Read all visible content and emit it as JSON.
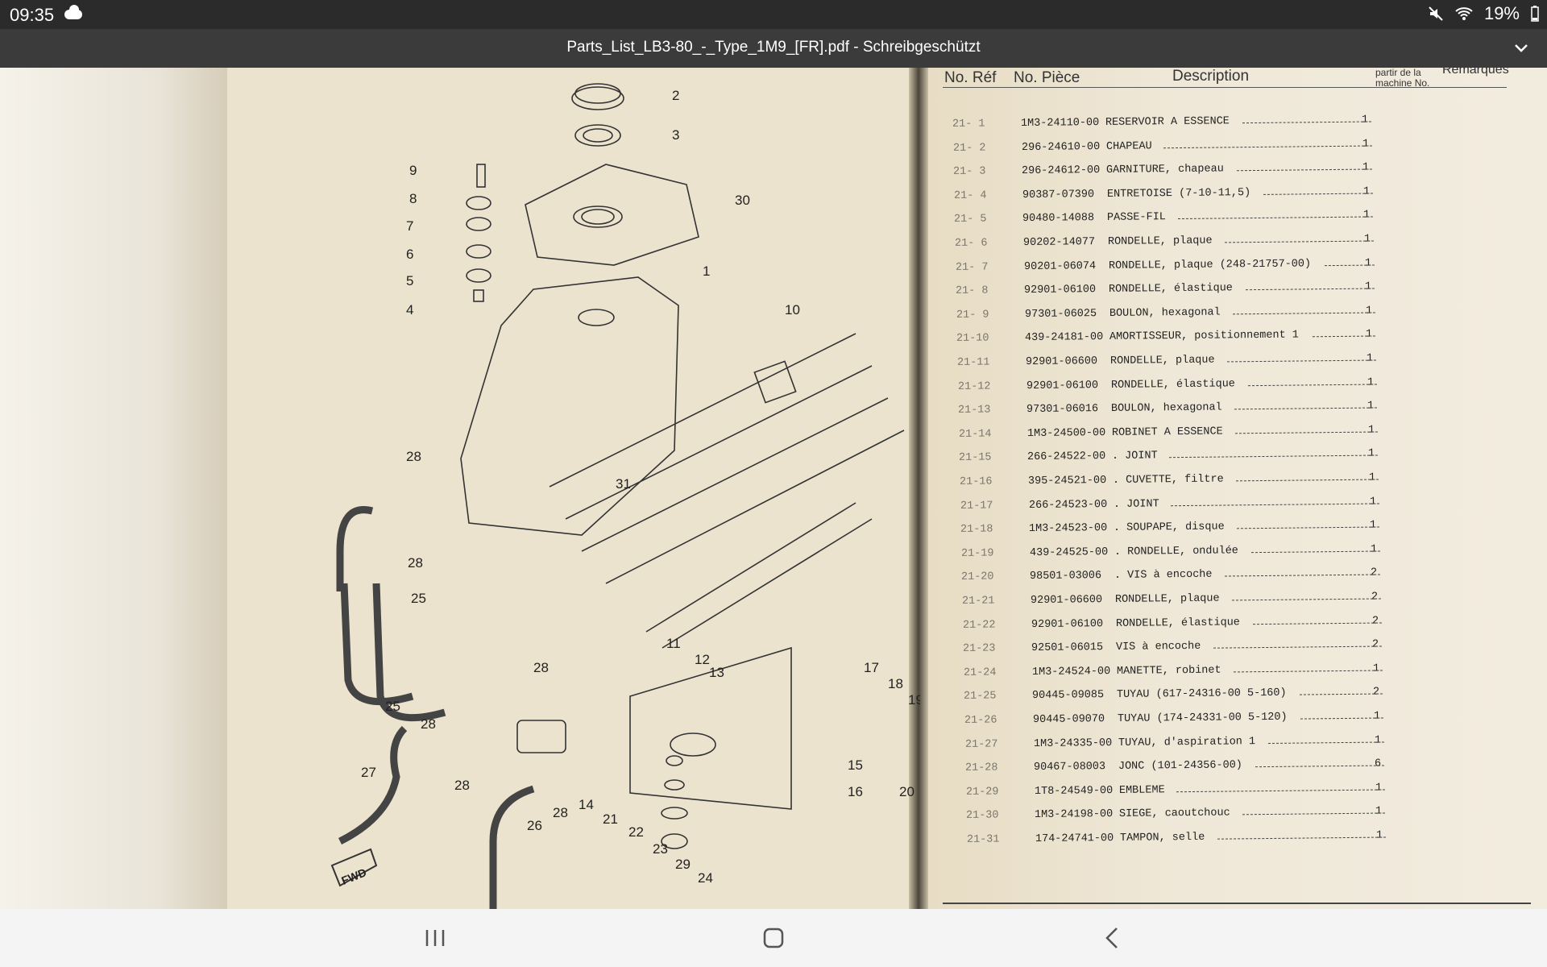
{
  "status": {
    "time": "09:35",
    "battery": "19%"
  },
  "title_bar": {
    "title": "Parts_List_LB3-80_-_Type_1M9_[FR].pdf - Schreibgeschützt"
  },
  "parts_table": {
    "headers": {
      "ref": "No. Réf",
      "part": "No. Pièce",
      "description": "Description",
      "remarks": "Remarques",
      "applicable": "partir de la\nmachine No."
    },
    "rows": [
      {
        "ref": "21- 1",
        "part": "1M3-24110-00",
        "desc": "RESERVOIR A ESSENCE",
        "qty": "1"
      },
      {
        "ref": "21- 2",
        "part": "296-24610-00",
        "desc": "CHAPEAU",
        "qty": "1"
      },
      {
        "ref": "21- 3",
        "part": "296-24612-00",
        "desc": "GARNITURE, chapeau",
        "qty": "1"
      },
      {
        "ref": "21- 4",
        "part": "90387-07390",
        "desc": "ENTRETOISE (7-10-11,5)",
        "qty": "1"
      },
      {
        "ref": "21- 5",
        "part": "90480-14088",
        "desc": "PASSE-FIL",
        "qty": "1"
      },
      {
        "ref": "21- 6",
        "part": "90202-14077",
        "desc": "RONDELLE, plaque",
        "qty": "1"
      },
      {
        "ref": "21- 7",
        "part": "90201-06074",
        "desc": "RONDELLE, plaque (248-21757-00)",
        "qty": "1"
      },
      {
        "ref": "21- 8",
        "part": "92901-06100",
        "desc": "RONDELLE, élastique",
        "qty": "1"
      },
      {
        "ref": "21- 9",
        "part": "97301-06025",
        "desc": "BOULON, hexagonal",
        "qty": "1"
      },
      {
        "ref": "21-10",
        "part": "439-24181-00",
        "desc": "AMORTISSEUR, positionnement 1",
        "qty": "1"
      },
      {
        "ref": "21-11",
        "part": "92901-06600",
        "desc": "RONDELLE, plaque",
        "qty": "1"
      },
      {
        "ref": "21-12",
        "part": "92901-06100",
        "desc": "RONDELLE, élastique",
        "qty": "1"
      },
      {
        "ref": "21-13",
        "part": "97301-06016",
        "desc": "BOULON, hexagonal",
        "qty": "1"
      },
      {
        "ref": "21-14",
        "part": "1M3-24500-00",
        "desc": "ROBINET A ESSENCE",
        "qty": "1"
      },
      {
        "ref": "21-15",
        "part": "266-24522-00",
        "desc": ". JOINT",
        "qty": "1"
      },
      {
        "ref": "21-16",
        "part": "395-24521-00",
        "desc": ". CUVETTE, filtre",
        "qty": "1"
      },
      {
        "ref": "21-17",
        "part": "266-24523-00",
        "desc": ". JOINT",
        "qty": "1"
      },
      {
        "ref": "21-18",
        "part": "1M3-24523-00",
        "desc": ". SOUPAPE, disque",
        "qty": "1"
      },
      {
        "ref": "21-19",
        "part": "439-24525-00",
        "desc": ". RONDELLE, ondulée",
        "qty": "1"
      },
      {
        "ref": "21-20",
        "part": "98501-03006",
        "desc": ". VIS à encoche",
        "qty": "2"
      },
      {
        "ref": "21-21",
        "part": "92901-06600",
        "desc": "RONDELLE, plaque",
        "qty": "2"
      },
      {
        "ref": "21-22",
        "part": "92901-06100",
        "desc": "RONDELLE, élastique",
        "qty": "2"
      },
      {
        "ref": "21-23",
        "part": "92501-06015",
        "desc": "VIS à encoche",
        "qty": "2"
      },
      {
        "ref": "21-24",
        "part": "1M3-24524-00",
        "desc": "MANETTE, robinet",
        "qty": "1"
      },
      {
        "ref": "21-25",
        "part": "90445-09085",
        "desc": "TUYAU (617-24316-00 5-160)",
        "qty": "2"
      },
      {
        "ref": "21-26",
        "part": "90445-09070",
        "desc": "TUYAU (174-24331-00 5-120)",
        "qty": "1"
      },
      {
        "ref": "21-27",
        "part": "1M3-24335-00",
        "desc": "TUYAU, d'aspiration 1",
        "qty": "1"
      },
      {
        "ref": "21-28",
        "part": "90467-08003",
        "desc": "JONC (101-24356-00)",
        "qty": "6"
      },
      {
        "ref": "21-29",
        "part": "1T8-24549-00",
        "desc": "EMBLEME",
        "qty": "1"
      },
      {
        "ref": "21-30",
        "part": "1M3-24198-00",
        "desc": "SIEGE, caoutchouc",
        "qty": "1"
      },
      {
        "ref": "21-31",
        "part": "174-24741-00",
        "desc": "TAMPON, selle",
        "qty": "1"
      }
    ]
  },
  "diagram": {
    "labels": [
      "2",
      "3",
      "30",
      "9",
      "8",
      "7",
      "6",
      "5",
      "4",
      "1",
      "10",
      "28",
      "31",
      "28",
      "25",
      "25",
      "28",
      "28",
      "27",
      "28",
      "11",
      "12",
      "13",
      "17",
      "18",
      "19",
      "14",
      "21",
      "22",
      "23",
      "29",
      "24",
      "15",
      "16",
      "20",
      "26",
      "28"
    ],
    "fwd": "FWD"
  }
}
